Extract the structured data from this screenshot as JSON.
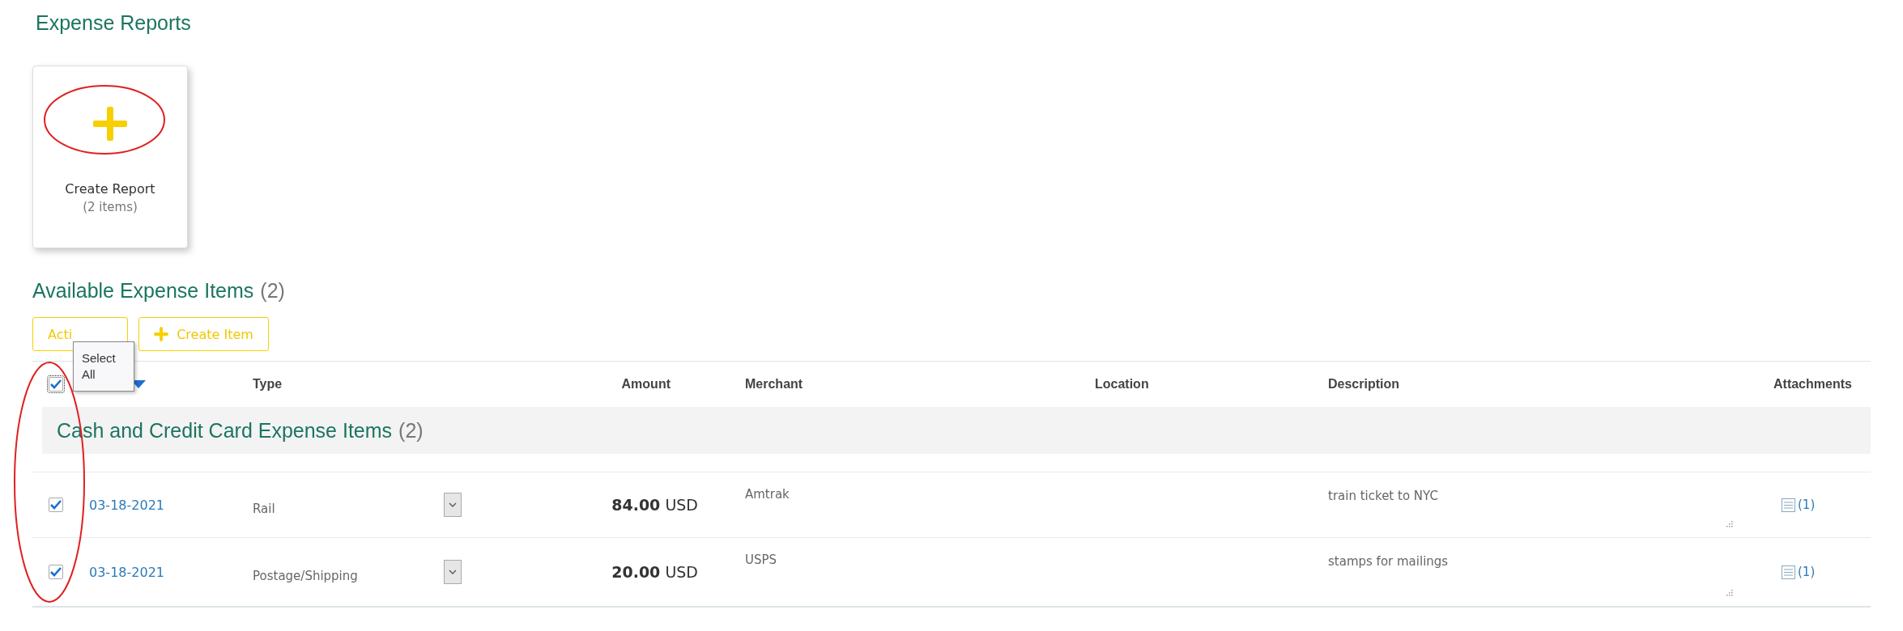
{
  "page_title": "Expense Reports",
  "create_tile": {
    "label": "Create Report",
    "count": "(2 items)",
    "circled": true
  },
  "section": {
    "title": "Available Expense Items",
    "count": "(2)"
  },
  "toolbar": {
    "actions_label": "Acti",
    "create_label": "Create Item"
  },
  "tooltip": "Select All",
  "table": {
    "select_all_checked": true,
    "select_column_circled": true,
    "sort_descending": true,
    "columns": [
      {
        "kind": "type",
        "label": "Type"
      },
      {
        "kind": "amount",
        "label": "Amount"
      },
      {
        "kind": "merchant",
        "label": "Merchant"
      },
      {
        "kind": "location",
        "label": "Location"
      },
      {
        "kind": "description",
        "label": "Description"
      },
      {
        "kind": "attachments",
        "label": "Attachments"
      }
    ],
    "group": {
      "title": "Cash and Credit Card Expense Items",
      "count": "(2)"
    },
    "rows": [
      {
        "checked": true,
        "date": "03-18-2021",
        "type": "Rail",
        "amount": "84.00",
        "currency": "USD",
        "merchant": "Amtrak",
        "description": "train ticket to NYC",
        "attachments": "(1)"
      },
      {
        "checked": true,
        "date": "03-18-2021",
        "type": "Postage/Shipping",
        "amount": "20.00",
        "currency": "USD",
        "merchant": "USPS",
        "description": "stamps for mailings",
        "attachments": "(1)"
      }
    ]
  }
}
